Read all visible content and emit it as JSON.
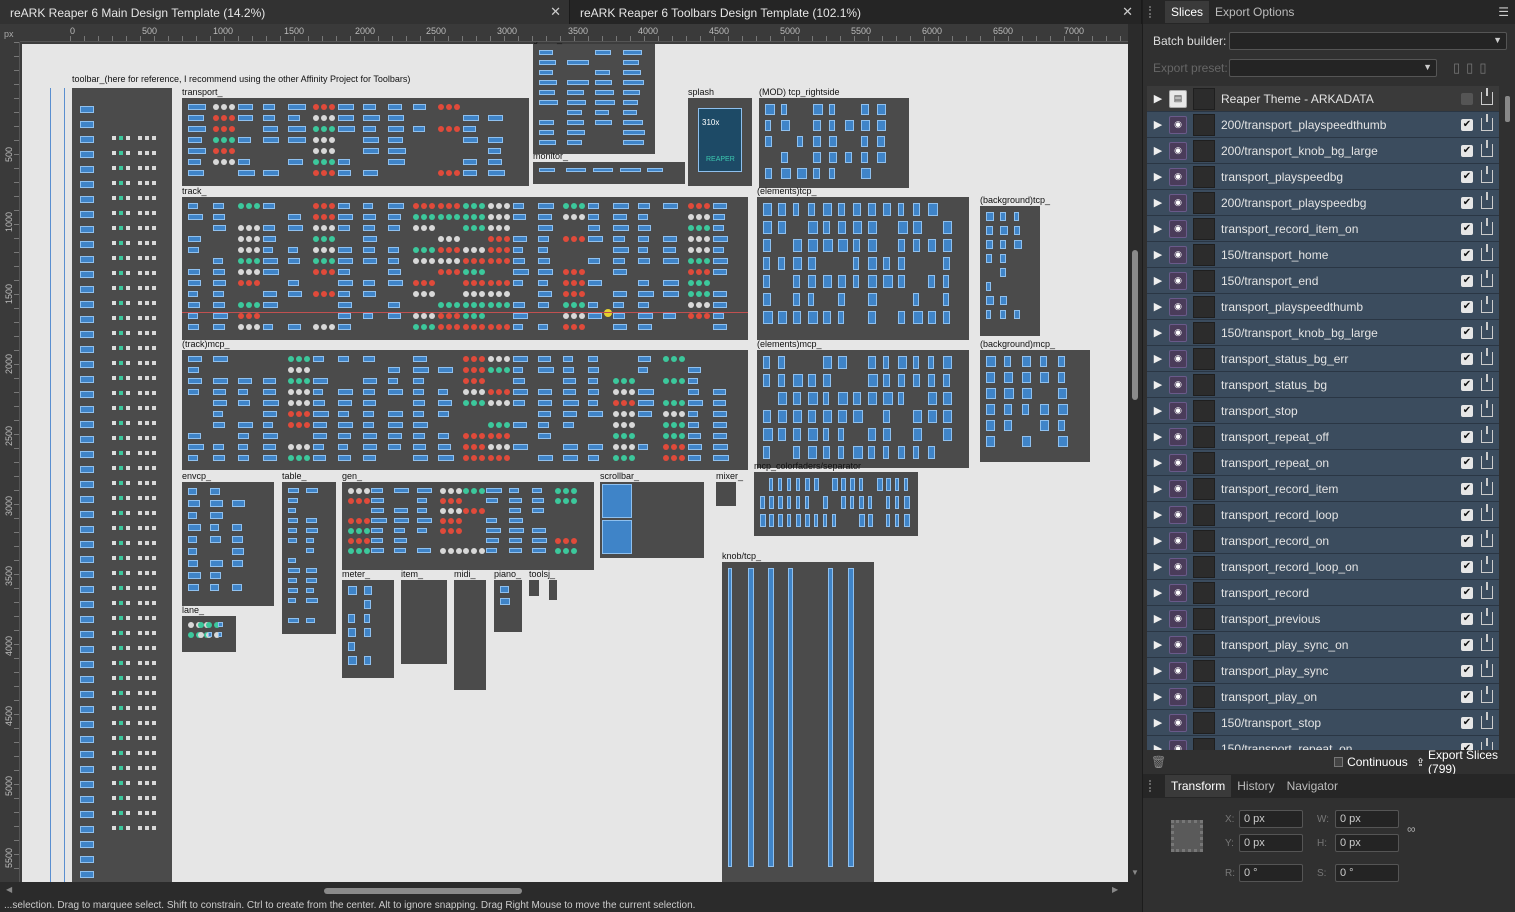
{
  "tabs": [
    {
      "label": "reARK Reaper 6 Main Design Template (14.2%)"
    },
    {
      "label": "reARK Reaper 6 Toolbars Design Template (102.1%)"
    }
  ],
  "ruler": {
    "unit": "px",
    "h_ticks": [
      "0",
      "500",
      "1000",
      "1500",
      "2000",
      "2500",
      "3000",
      "3500",
      "4000",
      "4500",
      "5000",
      "5500",
      "6000",
      "6500",
      "7000"
    ],
    "v_ticks": [
      "500",
      "1000",
      "1500",
      "2000",
      "2500",
      "3000",
      "3500",
      "4000",
      "4500",
      "5000",
      "5500"
    ]
  },
  "boards": {
    "toolbar": "toolbar_(here for reference, I recommend using the other Affinity Project for Toolbars)",
    "transport": "transport_",
    "global": "global_",
    "monitor": "monitor_",
    "splash": "splash",
    "splash_text": "REAPER",
    "splash_num": "310x",
    "mod_tcp": "(MOD) tcp_rightside",
    "track": "track_",
    "elements_tcp": "(elements)tcp_",
    "background_tcp": "(background)tcp_",
    "track_mcp": "(track)mcp_",
    "elements_mcp": "(elements)mcp_",
    "background_mcp": "(background)mcp_",
    "envcp": "envcp_",
    "table": "table_",
    "gen": "gen_",
    "scrollbar": "scrollbar_",
    "mixer": "mixer_",
    "mcp_colorfaders": "mcp_colorfaders/separator",
    "knob_tcp": "knob/tcp_",
    "meter": "meter_",
    "item": "item_",
    "midi": "midi_",
    "piano": "piano_",
    "toolstrip": "toolsj_",
    "lane": "lane_"
  },
  "statusbar": {
    "text": "...selection. Drag to marquee select. Shift to constrain. Ctrl to create from the center. Alt to ignore snapping. Drag Right Mouse to move the current selection."
  },
  "panel": {
    "tabs": [
      "Slices",
      "Export Options"
    ],
    "batch_builder_label": "Batch builder:",
    "export_preset_label": "Export preset:",
    "slices": [
      {
        "name": "Reaper Theme - ARKADATA",
        "checked": false
      },
      {
        "name": "200/transport_playspeedthumb",
        "checked": true
      },
      {
        "name": "200/transport_knob_bg_large",
        "checked": true
      },
      {
        "name": "transport_playspeedbg",
        "checked": true
      },
      {
        "name": "200/transport_playspeedbg",
        "checked": true
      },
      {
        "name": "transport_record_item_on",
        "checked": true
      },
      {
        "name": "150/transport_home",
        "checked": true
      },
      {
        "name": "150/transport_end",
        "checked": true
      },
      {
        "name": "transport_playspeedthumb",
        "checked": true
      },
      {
        "name": "150/transport_knob_bg_large",
        "checked": true
      },
      {
        "name": "transport_status_bg_err",
        "checked": true
      },
      {
        "name": "transport_status_bg",
        "checked": true
      },
      {
        "name": "transport_stop",
        "checked": true
      },
      {
        "name": "transport_repeat_off",
        "checked": true
      },
      {
        "name": "transport_repeat_on",
        "checked": true
      },
      {
        "name": "transport_record_item",
        "checked": true
      },
      {
        "name": "transport_record_loop",
        "checked": true
      },
      {
        "name": "transport_record_on",
        "checked": true
      },
      {
        "name": "transport_record_loop_on",
        "checked": true
      },
      {
        "name": "transport_record",
        "checked": true
      },
      {
        "name": "transport_previous",
        "checked": true
      },
      {
        "name": "transport_play_sync_on",
        "checked": true
      },
      {
        "name": "transport_play_sync",
        "checked": true
      },
      {
        "name": "transport_play_on",
        "checked": true
      },
      {
        "name": "150/transport_stop",
        "checked": true
      },
      {
        "name": "150/transport_repeat_on",
        "checked": true
      }
    ],
    "continuous_label": "Continuous",
    "export_slices_label": "Export Slices (799)",
    "lower_tabs": [
      "Transform",
      "History",
      "Navigator"
    ],
    "transform": {
      "x_label": "X:",
      "x": "0 px",
      "y_label": "Y:",
      "y": "0 px",
      "w_label": "W:",
      "w": "0 px",
      "h_label": "H:",
      "h": "0 px",
      "r_label": "R:",
      "r": "0 °",
      "s_label": "S:",
      "s": "0 °"
    }
  }
}
